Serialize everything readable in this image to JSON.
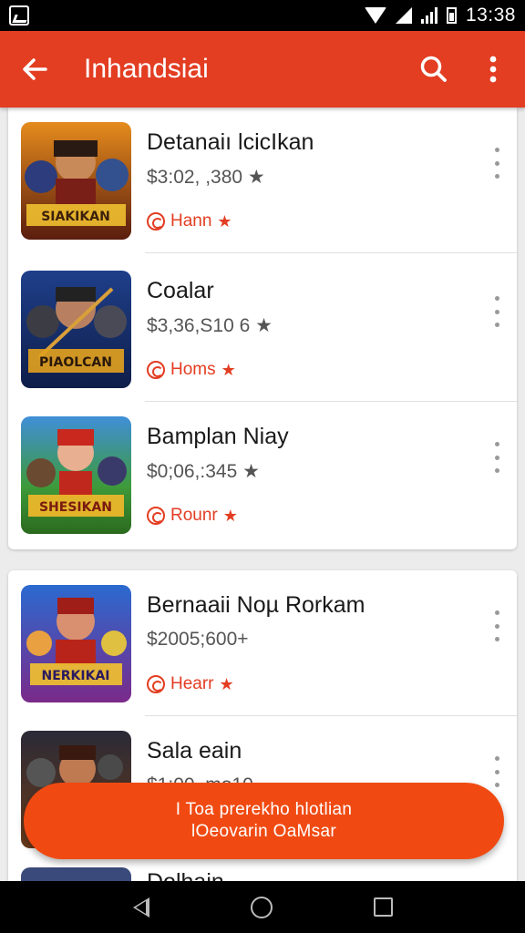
{
  "status_bar": {
    "time": "13:38"
  },
  "app_bar": {
    "title": "Inhandsiai"
  },
  "items": [
    {
      "name": "Detanaiı lcicIkan",
      "price": "$3:02, ,380 ★",
      "tag": "Hann",
      "thumb_label": "SIAKIKAN"
    },
    {
      "name": "Coalar",
      "price": "$3,36,S10 6 ★",
      "tag": "Homs",
      "thumb_label": "PIAOLCAN"
    },
    {
      "name": "Bamplan Niay",
      "price": "$0;06,:345 ★",
      "tag": "Rounr",
      "thumb_label": "SHESIKAN"
    },
    {
      "name": "Bernaaii Noµ Rorkam",
      "price": "$2005;600+",
      "tag": "Hearr",
      "thumb_label": "NERKIKAI"
    },
    {
      "name": "Sala eain",
      "price": "$1:00, mo10",
      "tag": "",
      "thumb_label": ""
    }
  ],
  "partial_item": {
    "name": "Dolhain"
  },
  "cta": {
    "line1": "I Toa prerekho hlotlian",
    "line2": "lOeovarin OaMsar"
  },
  "colors": {
    "accent": "#e33d22",
    "cta": "#f04a12"
  },
  "icons": [
    "back-arrow-icon",
    "search-icon",
    "more-vert-icon",
    "gallery-icon",
    "wifi-icon",
    "signal-icon",
    "battery-icon"
  ]
}
